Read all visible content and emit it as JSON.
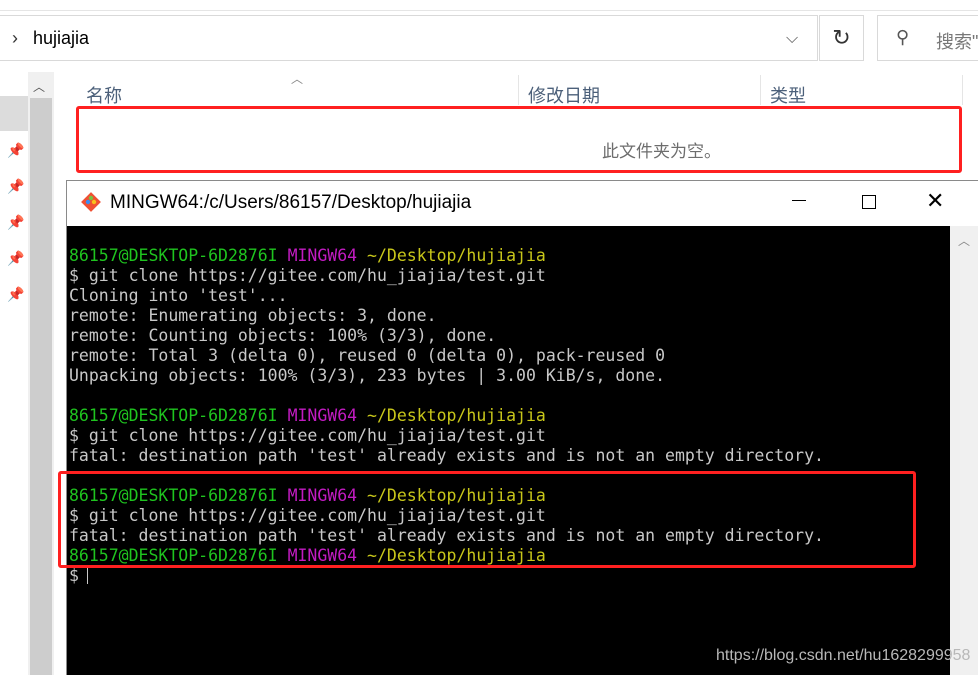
{
  "explorer": {
    "address": {
      "path": "hujiajia",
      "chevron_icon": "chevron-right-icon",
      "dropdown_icon": "chevron-down-icon"
    },
    "refresh_icon": "refresh-icon",
    "search": {
      "icon": "search-icon",
      "placeholder": "搜索\""
    },
    "columns": [
      "名称",
      "修改日期",
      "类型"
    ],
    "empty_message": "此文件夹为空。",
    "pin_icons": [
      "pin-icon",
      "pin-icon",
      "pin-icon",
      "pin-icon",
      "pin-icon"
    ]
  },
  "terminal": {
    "title": "MINGW64:/c/Users/86157/Desktop/hujiajia",
    "buttons": {
      "minimize": "minimize-icon",
      "maximize": "maximize-icon",
      "close": "close-icon"
    },
    "prompt": {
      "user": "86157@DESKTOP-6D2876I",
      "shell": "MINGW64",
      "path": "~/Desktop/hujiajia"
    },
    "lines": [
      {
        "kind": "prompt"
      },
      {
        "kind": "text",
        "text": "$ git clone https://gitee.com/hu_jiajia/test.git"
      },
      {
        "kind": "text",
        "text": "Cloning into 'test'..."
      },
      {
        "kind": "text",
        "text": "remote: Enumerating objects: 3, done."
      },
      {
        "kind": "text",
        "text": "remote: Counting objects: 100% (3/3), done."
      },
      {
        "kind": "text",
        "text": "remote: Total 3 (delta 0), reused 0 (delta 0), pack-reused 0"
      },
      {
        "kind": "text",
        "text": "Unpacking objects: 100% (3/3), 233 bytes | 3.00 KiB/s, done."
      },
      {
        "kind": "text",
        "text": ""
      },
      {
        "kind": "prompt"
      },
      {
        "kind": "text",
        "text": "$ git clone https://gitee.com/hu_jiajia/test.git"
      },
      {
        "kind": "text",
        "text": "fatal: destination path 'test' already exists and is not an empty directory."
      },
      {
        "kind": "text",
        "text": ""
      },
      {
        "kind": "prompt"
      },
      {
        "kind": "text",
        "text": "$ git clone https://gitee.com/hu_jiajia/test.git"
      },
      {
        "kind": "text",
        "text": "fatal: destination path 'test' already exists and is not an empty directory."
      },
      {
        "kind": "prompt"
      },
      {
        "kind": "cursor",
        "text": "$"
      }
    ],
    "colors": {
      "user": "#1fc41f",
      "shell": "#c21bc2",
      "path": "#c8c71a",
      "text": "#c8c8c8",
      "background": "#000000"
    }
  },
  "annotation": {
    "highlight_color": "#ff2020"
  },
  "watermark": "https://blog.csdn.net/hu1628299958"
}
